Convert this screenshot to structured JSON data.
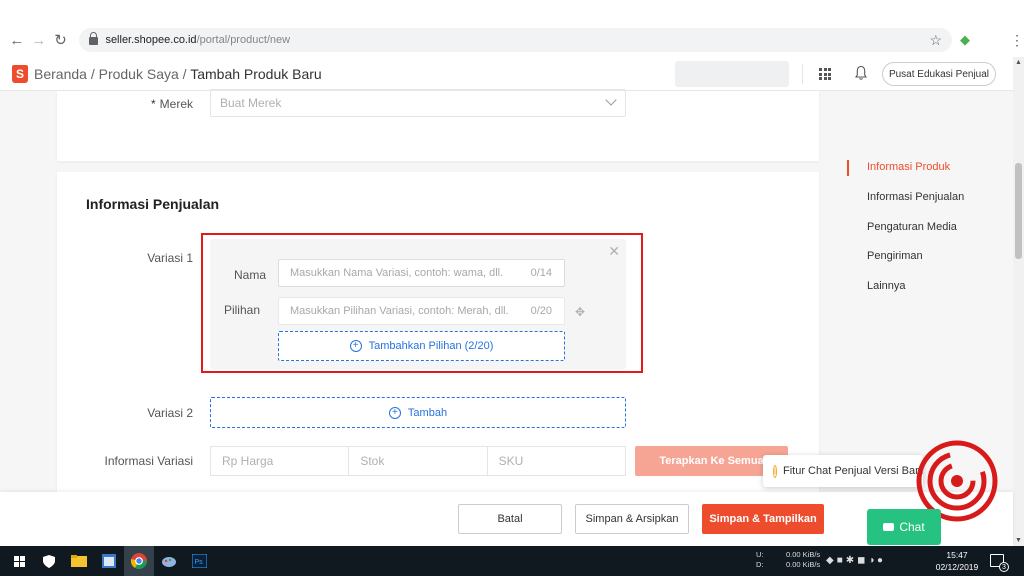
{
  "browser": {
    "url_host": "seller.shopee.co.id",
    "url_path": "/portal/product/new"
  },
  "header": {
    "logo_letter": "S",
    "crumb_home": "Beranda",
    "crumb_separator": " / ",
    "crumb_products": "Produk Saya",
    "crumb_current": "Tambah Produk Baru",
    "edu_button": "Pusat Edukasi Penjual"
  },
  "brand_field": {
    "label": "Merek",
    "required_mark": "*",
    "placeholder": "Buat Merek"
  },
  "sales": {
    "title": "Informasi Penjualan",
    "variation1": {
      "label": "Variasi 1",
      "name_label": "Nama",
      "name_placeholder": "Masukkan Nama Variasi, contoh: wama, dll.",
      "name_counter": "0/14",
      "option_label": "Pilihan",
      "option_placeholder": "Masukkan Pilihan Variasi, contoh: Merah, dll.",
      "option_counter": "0/20",
      "add_option_button": "Tambahkan Pilihan (2/20)"
    },
    "variation2": {
      "label": "Variasi 2",
      "add_button": "Tambah"
    },
    "variation_info": {
      "label": "Informasi Variasi",
      "price_placeholder": "Rp Harga",
      "stock_placeholder": "Stok",
      "sku_placeholder": "SKU",
      "apply_all_button": "Terapkan Ke Semua"
    }
  },
  "side_nav": {
    "items": [
      {
        "label": "Informasi Produk",
        "active": true
      },
      {
        "label": "Informasi Penjualan",
        "active": false
      },
      {
        "label": "Pengaturan Media",
        "active": false
      },
      {
        "label": "Pengiriman",
        "active": false
      },
      {
        "label": "Lainnya",
        "active": false
      }
    ]
  },
  "actions": {
    "cancel": "Batal",
    "save_archive": "Simpan & Arsipkan",
    "save_show": "Simpan & Tampilkan"
  },
  "chat": {
    "tooltip": "Fitur Chat Penjual Versi Baru",
    "button": "Chat"
  },
  "taskbar": {
    "upload_label": "U:",
    "download_label": "D:",
    "upload_rate": "0.00 KiB/s",
    "download_rate": "0.00 KiB/s",
    "time": "15:47",
    "date": "02/12/2019",
    "notification_count": "3"
  },
  "colors": {
    "brand": "#ee4d2d",
    "link_blue": "#2673dd",
    "highlight_red": "#e11b1b",
    "chat_green": "#26c281"
  }
}
